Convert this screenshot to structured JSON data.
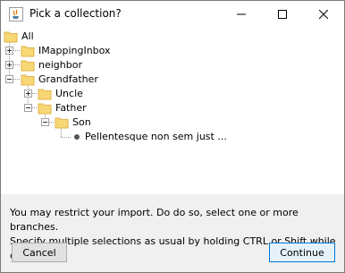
{
  "window": {
    "title": "Pick a collection?"
  },
  "tree": {
    "root": {
      "label": "All"
    },
    "items": [
      {
        "label": "IMappingInbox",
        "state": "collapsed"
      },
      {
        "label": "neighbor",
        "state": "collapsed"
      },
      {
        "label": "Grandfather",
        "state": "expanded"
      },
      {
        "label": "Uncle",
        "state": "collapsed"
      },
      {
        "label": "Father",
        "state": "expanded"
      },
      {
        "label": "Son",
        "state": "expanded"
      },
      {
        "label": "Pellentesque non sem just ..."
      }
    ]
  },
  "footer": {
    "hint_line1": "You may restrict your import. Do do so, select one or more branches.",
    "hint_line2": "Specify multiple selections as usual by holding CTRL or Shift while clicking.",
    "cancel_label": "Cancel",
    "continue_label": "Continue"
  },
  "colors": {
    "folder": "#f8d775",
    "folder_dark": "#e0b34a",
    "accent": "#0078d7"
  }
}
